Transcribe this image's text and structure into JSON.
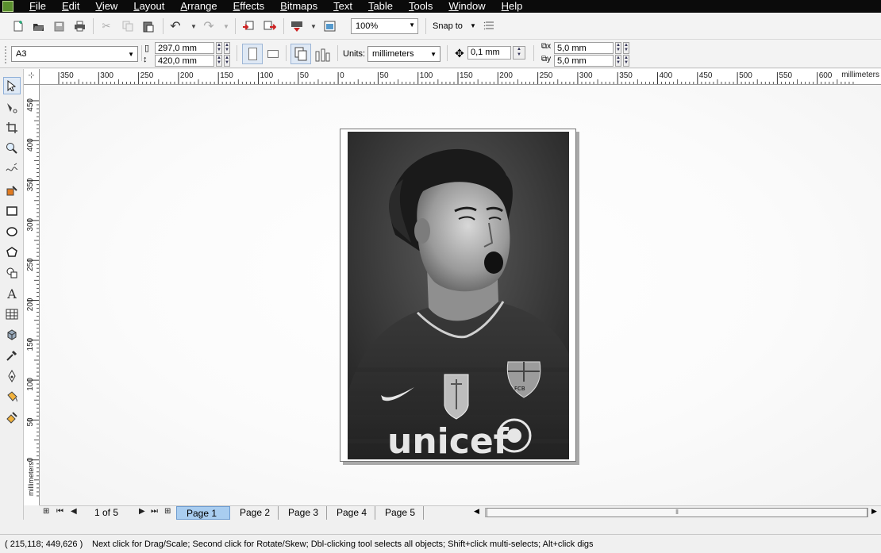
{
  "menu": [
    "File",
    "Edit",
    "View",
    "Layout",
    "Arrange",
    "Effects",
    "Bitmaps",
    "Text",
    "Table",
    "Tools",
    "Window",
    "Help"
  ],
  "toolbar": {
    "zoom": "100%",
    "snap_to": "Snap to"
  },
  "property_bar": {
    "paper_size": "A3",
    "width": "297,0 mm",
    "height": "420,0 mm",
    "units_label": "Units:",
    "units": "millimeters",
    "nudge": "0,1 mm",
    "dup_x": "5,0 mm",
    "dup_y": "5,0 mm"
  },
  "ruler_top": {
    "unit": "millimeters",
    "ticks": [
      "350",
      "300",
      "250",
      "200",
      "150",
      "100",
      "50",
      "0",
      "50",
      "100",
      "150",
      "200",
      "250",
      "300",
      "350",
      "400",
      "450",
      "500",
      "550",
      "600"
    ]
  },
  "ruler_left": {
    "unit": "millimeters",
    "ticks": [
      "450",
      "400",
      "350",
      "300",
      "250",
      "200",
      "150",
      "100",
      "50",
      "0"
    ]
  },
  "toolbox": [
    "pick-tool",
    "shape-tool",
    "crop-tool",
    "zoom-tool",
    "freehand-tool",
    "smart-fill-tool",
    "rectangle-tool",
    "ellipse-tool",
    "polygon-tool",
    "basic-shapes-tool",
    "text-tool",
    "table-tool",
    "blend-tool",
    "eyedropper-tool",
    "outline-tool",
    "fill-tool",
    "interactive-fill-tool"
  ],
  "canvas": {
    "photo_text": "unicef"
  },
  "pages": {
    "counter": "1 of 5",
    "tabs": [
      "Page 1",
      "Page 2",
      "Page 3",
      "Page 4",
      "Page 5"
    ],
    "active": 0
  },
  "status": {
    "coords": "( 215,118; 449,626 )",
    "hint": "Next click for Drag/Scale; Second click for Rotate/Skew; Dbl-clicking tool selects all objects; Shift+click multi-selects; Alt+click digs"
  }
}
